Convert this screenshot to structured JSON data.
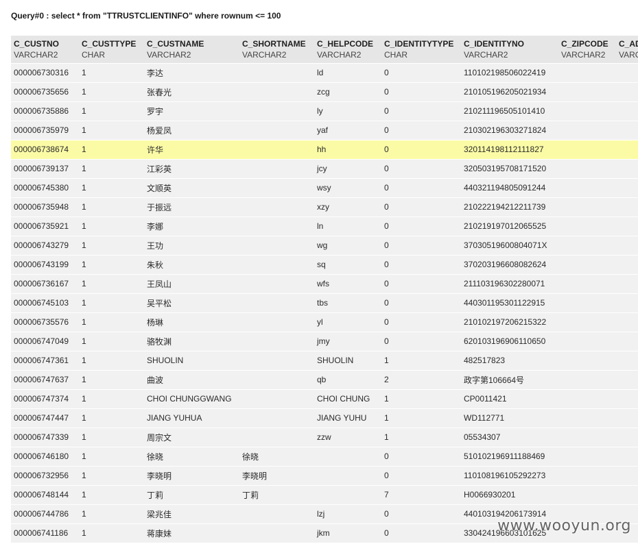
{
  "query": {
    "title": "Query#0 : select * from \"TTRUSTCLIENTINFO\" where rownum <= 100"
  },
  "table": {
    "columns": [
      {
        "name": "C_CUSTNO",
        "type": "VARCHAR2"
      },
      {
        "name": "C_CUSTTYPE",
        "type": "CHAR"
      },
      {
        "name": "C_CUSTNAME",
        "type": "VARCHAR2"
      },
      {
        "name": "C_SHORTNAME",
        "type": "VARCHAR2"
      },
      {
        "name": "C_HELPCODE",
        "type": "VARCHAR2"
      },
      {
        "name": "C_IDENTITYTYPE",
        "type": "CHAR"
      },
      {
        "name": "C_IDENTITYNO",
        "type": "VARCHAR2"
      },
      {
        "name": "C_ZIPCODE",
        "type": "VARCHAR2"
      },
      {
        "name": "C_AD",
        "type": "VARC"
      }
    ],
    "highlighted_row": 4,
    "rows": [
      [
        "000006730316",
        "1",
        "李达",
        "",
        "ld",
        "0",
        "110102198506022419",
        "",
        ""
      ],
      [
        "000006735656",
        "1",
        "张春光",
        "",
        "zcg",
        "0",
        "210105196205021934",
        "",
        ""
      ],
      [
        "000006735886",
        "1",
        "罗宇",
        "",
        "ly",
        "0",
        "210211196505101410",
        "",
        ""
      ],
      [
        "000006735979",
        "1",
        "杨爱凤",
        "",
        "yaf",
        "0",
        "210302196303271824",
        "",
        ""
      ],
      [
        "000006738674",
        "1",
        "许华",
        "",
        "hh",
        "0",
        "320114198112111827",
        "",
        ""
      ],
      [
        "000006739137",
        "1",
        "江彩英",
        "",
        "jcy",
        "0",
        "320503195708171520",
        "",
        ""
      ],
      [
        "000006745380",
        "1",
        "文顺英",
        "",
        "wsy",
        "0",
        "440321194805091244",
        "",
        ""
      ],
      [
        "000006735948",
        "1",
        "于振远",
        "",
        "xzy",
        "0",
        "210222194212211739",
        "",
        ""
      ],
      [
        "000006735921",
        "1",
        "李娜",
        "",
        "ln",
        "0",
        "210219197012065525",
        "",
        ""
      ],
      [
        "000006743279",
        "1",
        "王功",
        "",
        "wg",
        "0",
        "37030519600804071X",
        "",
        ""
      ],
      [
        "000006743199",
        "1",
        "朱秋",
        "",
        "sq",
        "0",
        "370203196608082624",
        "",
        ""
      ],
      [
        "000006736167",
        "1",
        "王凤山",
        "",
        "wfs",
        "0",
        "211103196302280071",
        "",
        ""
      ],
      [
        "000006745103",
        "1",
        "吴平松",
        "",
        "tbs",
        "0",
        "440301195301122915",
        "",
        ""
      ],
      [
        "000006735576",
        "1",
        "杨琳",
        "",
        "yl",
        "0",
        "210102197206215322",
        "",
        ""
      ],
      [
        "000006747049",
        "1",
        "骆牧渊",
        "",
        "jmy",
        "0",
        "620103196906110650",
        "",
        ""
      ],
      [
        "000006747361",
        "1",
        "SHUOLIN",
        "",
        "SHUOLIN",
        "1",
        "482517823",
        "",
        ""
      ],
      [
        "000006747637",
        "1",
        "曲波",
        "",
        "qb",
        "2",
        "政字第106664号",
        "",
        ""
      ],
      [
        "000006747374",
        "1",
        "CHOI CHUNGGWANG",
        "",
        "CHOI CHUNG",
        "1",
        "CP0011421",
        "",
        ""
      ],
      [
        "000006747447",
        "1",
        "JIANG YUHUA",
        "",
        "JIANG YUHU",
        "1",
        "WD112771",
        "",
        ""
      ],
      [
        "000006747339",
        "1",
        "周宗文",
        "",
        "zzw",
        "1",
        "05534307",
        "",
        ""
      ],
      [
        "000006746180",
        "1",
        "徐晓",
        "徐晓",
        "",
        "0",
        "510102196911188469",
        "",
        ""
      ],
      [
        "000006732956",
        "1",
        "李晓明",
        "李晓明",
        "",
        "0",
        "110108196105292273",
        "",
        ""
      ],
      [
        "000006748144",
        "1",
        "丁莉",
        "丁莉",
        "",
        "7",
        "H0066930201",
        "",
        ""
      ],
      [
        "000006744786",
        "1",
        "梁兆佳",
        "",
        "lzj",
        "0",
        "440103194206173914",
        "",
        ""
      ],
      [
        "000006741186",
        "1",
        "蒋康妹",
        "",
        "jkm",
        "0",
        "330424196603101625",
        "",
        ""
      ]
    ]
  },
  "watermark": {
    "text": "www.wooyun.org"
  }
}
